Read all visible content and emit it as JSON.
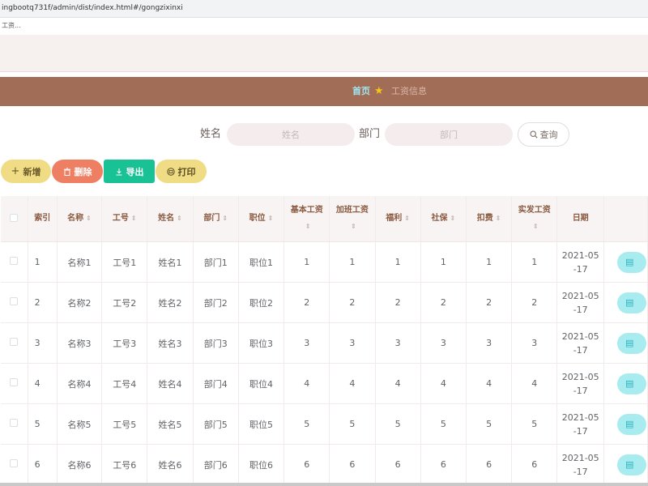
{
  "browser": {
    "url": "ingbootq731f/admin/dist/index.html#/gongzixinxi",
    "tab_text": "工资..."
  },
  "breadcrumb": {
    "home": "首页",
    "separator": "★",
    "current": "工资信息"
  },
  "search": {
    "name_label": "姓名",
    "name_placeholder": "姓名",
    "dept_label": "部门",
    "dept_placeholder": "部门",
    "query_button": "查询"
  },
  "actions": {
    "add": "新增",
    "delete": "删除",
    "export": "导出",
    "print": "打印"
  },
  "table": {
    "columns": [
      "",
      "索引",
      "名称",
      "工号",
      "姓名",
      "部门",
      "职位",
      "基本工资",
      "加班工资",
      "福利",
      "社保",
      "扣费",
      "实发工资",
      "日期",
      ""
    ],
    "rows": [
      [
        "1",
        "名称1",
        "工号1",
        "姓名1",
        "部门1",
        "职位1",
        "1",
        "1",
        "1",
        "1",
        "1",
        "1",
        "2021-05-17"
      ],
      [
        "2",
        "名称2",
        "工号2",
        "姓名2",
        "部门2",
        "职位2",
        "2",
        "2",
        "2",
        "2",
        "2",
        "2",
        "2021-05-17"
      ],
      [
        "3",
        "名称3",
        "工号3",
        "姓名3",
        "部门3",
        "职位3",
        "3",
        "3",
        "3",
        "3",
        "3",
        "3",
        "2021-05-17"
      ],
      [
        "4",
        "名称4",
        "工号4",
        "姓名4",
        "部门4",
        "职位4",
        "4",
        "4",
        "4",
        "4",
        "4",
        "4",
        "2021-05-17"
      ],
      [
        "5",
        "名称5",
        "工号5",
        "姓名5",
        "部门5",
        "职位5",
        "5",
        "5",
        "5",
        "5",
        "5",
        "5",
        "2021-05-17"
      ],
      [
        "6",
        "名称6",
        "工号6",
        "姓名6",
        "部门6",
        "职位6",
        "6",
        "6",
        "6",
        "6",
        "6",
        "6",
        "2021-05-17"
      ]
    ]
  },
  "colors": {
    "nav_bg": "#a26d57",
    "add_btn": "#f0dc84",
    "delete_btn": "#ee7f62",
    "export_btn": "#19c294",
    "print_btn": "#f0dc84"
  }
}
